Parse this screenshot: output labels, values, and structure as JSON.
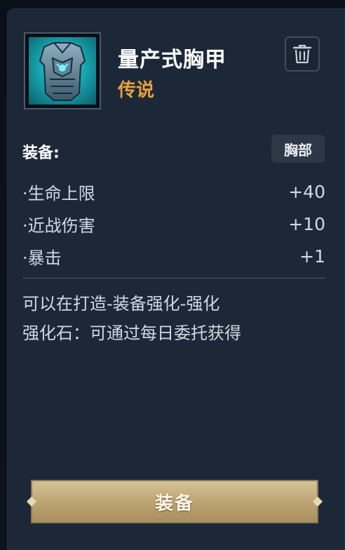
{
  "item": {
    "name": "量产式胸甲",
    "rarity": "传说",
    "rarity_color": "#e8a23c",
    "icon": "chest-armor-icon"
  },
  "actions": {
    "discard_icon": "trash-icon",
    "equip_label": "装备"
  },
  "equipment": {
    "section_label": "装备:",
    "slot": "胸部"
  },
  "stats": [
    {
      "name": "·生命上限",
      "value": "+40"
    },
    {
      "name": "·近战伤害",
      "value": "+10"
    },
    {
      "name": "·暴击",
      "value": "+1"
    }
  ],
  "description": {
    "line1": "可以在打造-装备强化-强化",
    "line2": "强化石：可通过每日委托获得"
  }
}
